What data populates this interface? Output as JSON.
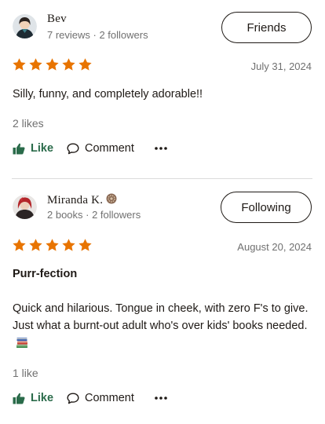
{
  "reviews": [
    {
      "reviewer": "Bev",
      "stats": "7 reviews · 2 followers",
      "follow_button": "Friends",
      "rating": 5,
      "date": "July 31, 2024",
      "body": "Silly, funny, and completely adorable!!",
      "likes": "2 likes",
      "like_label": "Like",
      "comment_label": "Comment"
    },
    {
      "reviewer": "Miranda K.",
      "stats": "2 books · 2 followers",
      "follow_button": "Following",
      "rating": 5,
      "date": "August 20, 2024",
      "title": "Purr-fection",
      "body": "Quick and hilarious. Tongue in cheek, with zero F's to give. Just what a burnt-out adult who's over kids' books needed.",
      "likes": "1 like",
      "like_label": "Like",
      "comment_label": "Comment"
    }
  ],
  "colors": {
    "star": "#e87400",
    "like_green": "#2a6b4a",
    "muted_text": "#707070"
  },
  "icons": {
    "like": "thumbs-up-icon",
    "comment": "speech-bubble-icon",
    "more": "more-dots-icon",
    "star": "star-icon",
    "books": "books-emoji-icon",
    "badge": "author-badge-icon"
  }
}
